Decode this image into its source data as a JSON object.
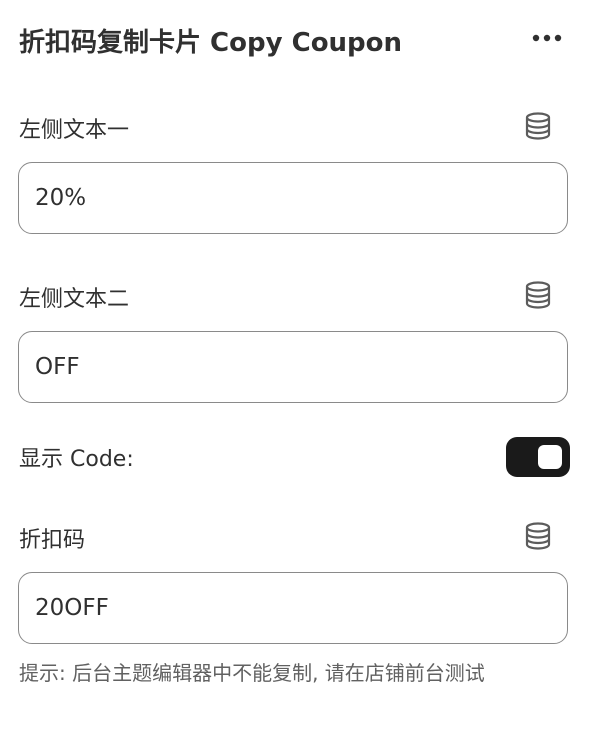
{
  "header": {
    "title": "折扣码复制卡片 Copy Coupon",
    "more_icon": "more-horizontal-icon"
  },
  "fields": [
    {
      "label": "左侧文本一",
      "value": "20%",
      "source_icon": "database-icon"
    },
    {
      "label": "左侧文本二",
      "value": "OFF",
      "source_icon": "database-icon"
    }
  ],
  "show_code": {
    "label": "显示 Code:",
    "enabled": true
  },
  "coupon_code": {
    "label": "折扣码",
    "value": "20OFF",
    "source_icon": "database-icon"
  },
  "help_text": "提示: 后台主题编辑器中不能复制, 请在店铺前台测试",
  "colors": {
    "text": "#303030",
    "border": "#8a8a8a",
    "toggle_on": "#1a1a1a",
    "help": "#616161"
  }
}
